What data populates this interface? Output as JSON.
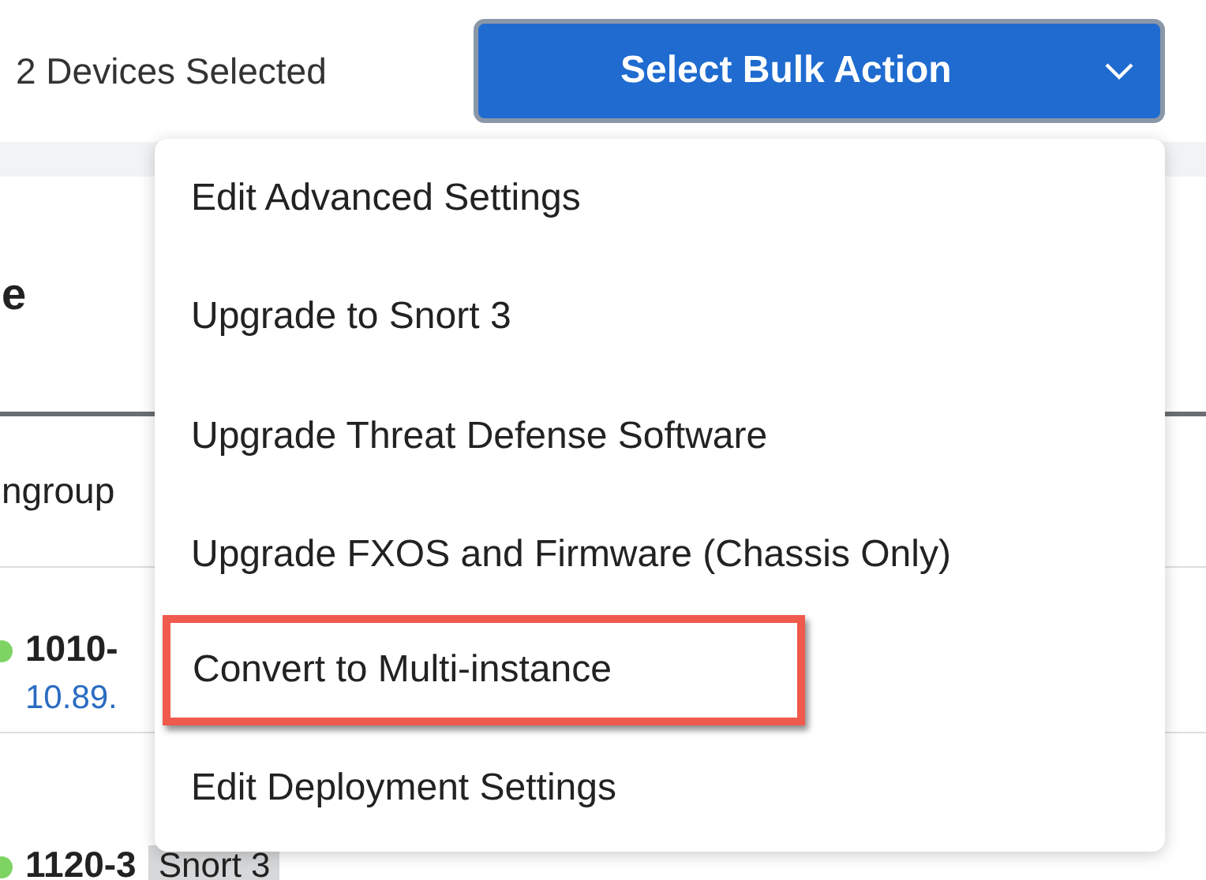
{
  "selection_count": "2 Devices Selected",
  "bulk_action_button": {
    "label": "Select Bulk Action"
  },
  "background": {
    "heading": "e",
    "group_label": "ngroup",
    "devices": [
      {
        "name": "1010-",
        "address": "10.89.",
        "color": "#7dd463"
      },
      {
        "name": "1120-3",
        "tag": "Snort 3",
        "color": "#7dd463"
      }
    ]
  },
  "menu_items": [
    {
      "label": "Edit Advanced Settings",
      "highlighted": false
    },
    {
      "label": "Upgrade to Snort 3",
      "highlighted": false
    },
    {
      "label": "Upgrade Threat Defense Software",
      "highlighted": false
    },
    {
      "label": "Upgrade FXOS and Firmware (Chassis Only)",
      "highlighted": false
    },
    {
      "label": "Convert to Multi-instance",
      "highlighted": true
    },
    {
      "label": "Edit Deployment Settings",
      "highlighted": false
    }
  ]
}
